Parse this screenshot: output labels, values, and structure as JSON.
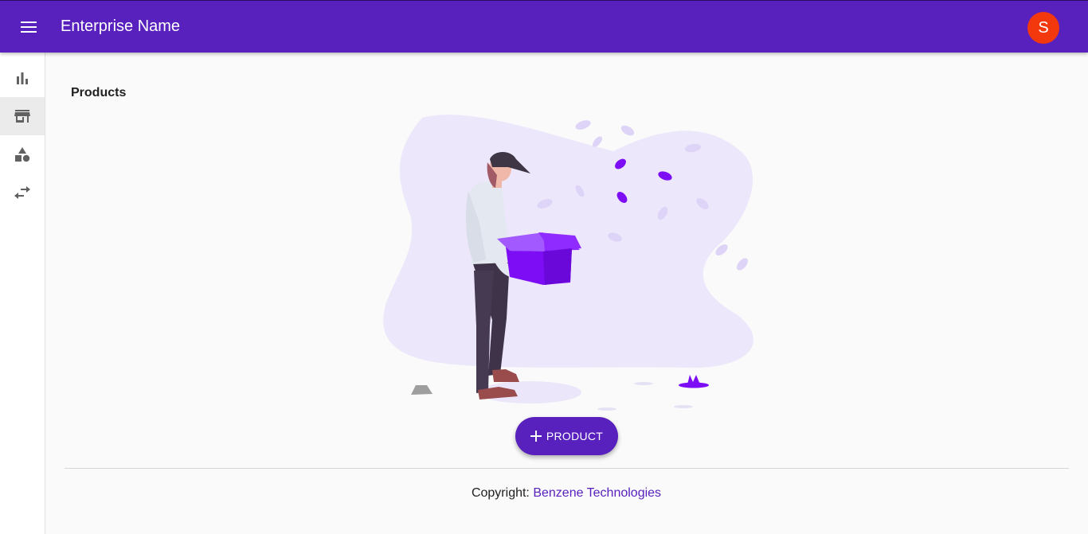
{
  "header": {
    "title": "Enterprise Name",
    "menu_icon": "menu-icon",
    "avatar_initial": "S",
    "color": "#5821be",
    "avatar_color": "#f4380e"
  },
  "sidebar": {
    "items": [
      {
        "icon": "bar-chart-icon",
        "active": false
      },
      {
        "icon": "store-icon",
        "active": true
      },
      {
        "icon": "category-icon",
        "active": false
      },
      {
        "icon": "swap-horiz-icon",
        "active": false
      }
    ]
  },
  "main": {
    "title": "Products",
    "add_button_label": "PRODUCT",
    "add_button_icon": "plus-icon"
  },
  "footer": {
    "copyright_label": "Copyright:",
    "company_link": "Benzene Technologies"
  }
}
